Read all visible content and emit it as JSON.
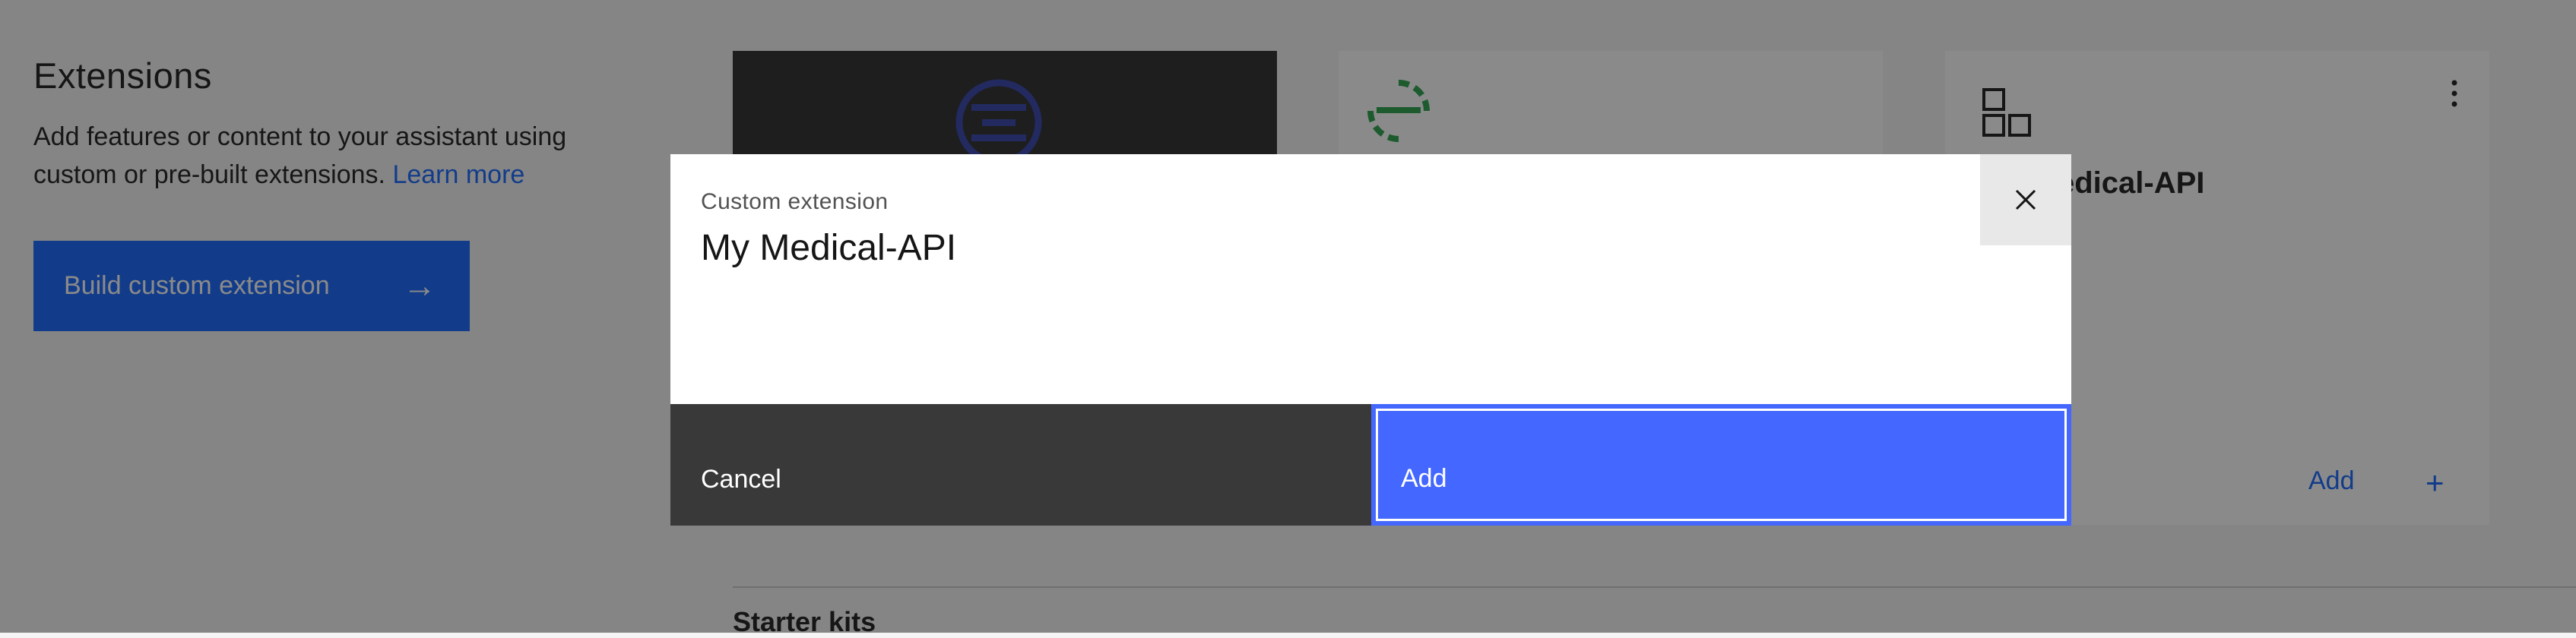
{
  "page": {
    "title": "Extensions",
    "description": "Add features or content to your assistant using custom or pre-built extensions.",
    "learn_more_link": "Learn more",
    "build_button_label": "Build custom extension"
  },
  "cards": {
    "custom_card": {
      "title": "My Medical-API",
      "add_label": "Add",
      "add_icon": "+"
    }
  },
  "starter_kits": {
    "heading": "Starter kits"
  },
  "modal": {
    "label": "Custom extension",
    "heading": "My Medical-API",
    "cancel_label": "Cancel",
    "add_label": "Add"
  },
  "colors": {
    "primary": "#0f62fe",
    "overlay": "rgba(22,22,22,0.5)",
    "modal_add": "#4468ff",
    "modal_cancel": "#393939",
    "logo_blue": "#2f3fa8",
    "logo_green": "#24a148"
  },
  "icons": {
    "learn_arrow": "arrow-right-icon",
    "close": "close-icon",
    "kebab": "overflow-menu-icon",
    "custom_ext": "custom-extension-icon"
  }
}
